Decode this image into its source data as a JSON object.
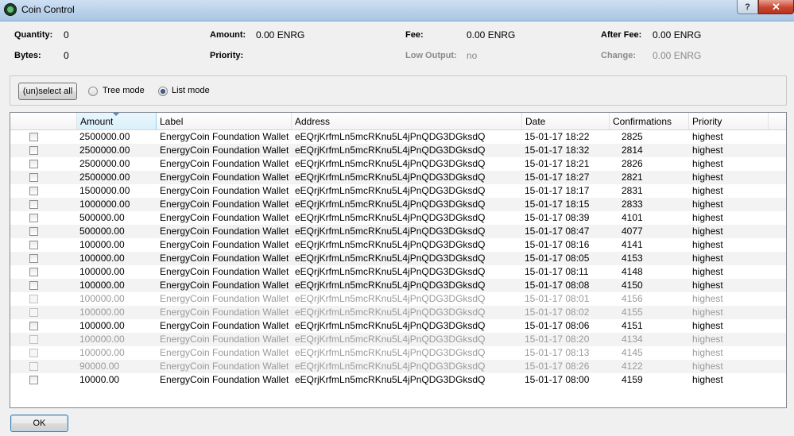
{
  "window": {
    "title": "Coin Control",
    "help_label": "?",
    "close_label": "✕"
  },
  "summary": {
    "quantity_label": "Quantity:",
    "quantity_value": "0",
    "bytes_label": "Bytes:",
    "bytes_value": "0",
    "amount_label": "Amount:",
    "amount_value": "0.00 ENRG",
    "priority_label": "Priority:",
    "priority_value": "",
    "fee_label": "Fee:",
    "fee_value": "0.00 ENRG",
    "low_output_label": "Low Output:",
    "low_output_value": "no",
    "after_fee_label": "After Fee:",
    "after_fee_value": "0.00 ENRG",
    "change_label": "Change:",
    "change_value": "0.00 ENRG"
  },
  "modebar": {
    "unselect_label": "(un)select all",
    "tree_mode_label": "Tree mode",
    "list_mode_label": "List mode",
    "selected_mode": "list"
  },
  "table": {
    "columns": [
      "Amount",
      "Label",
      "Address",
      "Date",
      "Confirmations",
      "Priority"
    ],
    "sorted_column": "Amount",
    "rows": [
      {
        "amount": "2500000.00",
        "label": "EnergyCoin Foundation Wallet",
        "address": "eEQrjKrfmLn5mcRKnu5L4jPnQDG3DGksdQ",
        "date": "15-01-17 18:22",
        "confirmations": "2825",
        "priority": "highest",
        "locked": false
      },
      {
        "amount": "2500000.00",
        "label": "EnergyCoin Foundation Wallet",
        "address": "eEQrjKrfmLn5mcRKnu5L4jPnQDG3DGksdQ",
        "date": "15-01-17 18:32",
        "confirmations": "2814",
        "priority": "highest",
        "locked": false
      },
      {
        "amount": "2500000.00",
        "label": "EnergyCoin Foundation Wallet",
        "address": "eEQrjKrfmLn5mcRKnu5L4jPnQDG3DGksdQ",
        "date": "15-01-17 18:21",
        "confirmations": "2826",
        "priority": "highest",
        "locked": false
      },
      {
        "amount": "2500000.00",
        "label": "EnergyCoin Foundation Wallet",
        "address": "eEQrjKrfmLn5mcRKnu5L4jPnQDG3DGksdQ",
        "date": "15-01-17 18:27",
        "confirmations": "2821",
        "priority": "highest",
        "locked": false
      },
      {
        "amount": "1500000.00",
        "label": "EnergyCoin Foundation Wallet",
        "address": "eEQrjKrfmLn5mcRKnu5L4jPnQDG3DGksdQ",
        "date": "15-01-17 18:17",
        "confirmations": "2831",
        "priority": "highest",
        "locked": false
      },
      {
        "amount": "1000000.00",
        "label": "EnergyCoin Foundation Wallet",
        "address": "eEQrjKrfmLn5mcRKnu5L4jPnQDG3DGksdQ",
        "date": "15-01-17 18:15",
        "confirmations": "2833",
        "priority": "highest",
        "locked": false
      },
      {
        "amount": "500000.00",
        "label": "EnergyCoin Foundation Wallet",
        "address": "eEQrjKrfmLn5mcRKnu5L4jPnQDG3DGksdQ",
        "date": "15-01-17 08:39",
        "confirmations": "4101",
        "priority": "highest",
        "locked": false
      },
      {
        "amount": "500000.00",
        "label": "EnergyCoin Foundation Wallet",
        "address": "eEQrjKrfmLn5mcRKnu5L4jPnQDG3DGksdQ",
        "date": "15-01-17 08:47",
        "confirmations": "4077",
        "priority": "highest",
        "locked": false
      },
      {
        "amount": "100000.00",
        "label": "EnergyCoin Foundation Wallet",
        "address": "eEQrjKrfmLn5mcRKnu5L4jPnQDG3DGksdQ",
        "date": "15-01-17 08:16",
        "confirmations": "4141",
        "priority": "highest",
        "locked": false
      },
      {
        "amount": "100000.00",
        "label": "EnergyCoin Foundation Wallet",
        "address": "eEQrjKrfmLn5mcRKnu5L4jPnQDG3DGksdQ",
        "date": "15-01-17 08:05",
        "confirmations": "4153",
        "priority": "highest",
        "locked": false
      },
      {
        "amount": "100000.00",
        "label": "EnergyCoin Foundation Wallet",
        "address": "eEQrjKrfmLn5mcRKnu5L4jPnQDG3DGksdQ",
        "date": "15-01-17 08:11",
        "confirmations": "4148",
        "priority": "highest",
        "locked": false
      },
      {
        "amount": "100000.00",
        "label": "EnergyCoin Foundation Wallet",
        "address": "eEQrjKrfmLn5mcRKnu5L4jPnQDG3DGksdQ",
        "date": "15-01-17 08:08",
        "confirmations": "4150",
        "priority": "highest",
        "locked": false
      },
      {
        "amount": "100000.00",
        "label": "EnergyCoin Foundation Wallet",
        "address": "eEQrjKrfmLn5mcRKnu5L4jPnQDG3DGksdQ",
        "date": "15-01-17 08:01",
        "confirmations": "4156",
        "priority": "highest",
        "locked": true
      },
      {
        "amount": "100000.00",
        "label": "EnergyCoin Foundation Wallet",
        "address": "eEQrjKrfmLn5mcRKnu5L4jPnQDG3DGksdQ",
        "date": "15-01-17 08:02",
        "confirmations": "4155",
        "priority": "highest",
        "locked": true
      },
      {
        "amount": "100000.00",
        "label": "EnergyCoin Foundation Wallet",
        "address": "eEQrjKrfmLn5mcRKnu5L4jPnQDG3DGksdQ",
        "date": "15-01-17 08:06",
        "confirmations": "4151",
        "priority": "highest",
        "locked": false
      },
      {
        "amount": "100000.00",
        "label": "EnergyCoin Foundation Wallet",
        "address": "eEQrjKrfmLn5mcRKnu5L4jPnQDG3DGksdQ",
        "date": "15-01-17 08:20",
        "confirmations": "4134",
        "priority": "highest",
        "locked": true
      },
      {
        "amount": "100000.00",
        "label": "EnergyCoin Foundation Wallet",
        "address": "eEQrjKrfmLn5mcRKnu5L4jPnQDG3DGksdQ",
        "date": "15-01-17 08:13",
        "confirmations": "4145",
        "priority": "highest",
        "locked": true
      },
      {
        "amount": "90000.00",
        "label": "EnergyCoin Foundation Wallet",
        "address": "eEQrjKrfmLn5mcRKnu5L4jPnQDG3DGksdQ",
        "date": "15-01-17 08:26",
        "confirmations": "4122",
        "priority": "highest",
        "locked": true
      },
      {
        "amount": "10000.00",
        "label": "EnergyCoin Foundation Wallet",
        "address": "eEQrjKrfmLn5mcRKnu5L4jPnQDG3DGksdQ",
        "date": "15-01-17 08:00",
        "confirmations": "4159",
        "priority": "highest",
        "locked": false
      }
    ]
  },
  "footer": {
    "ok_label": "OK"
  }
}
